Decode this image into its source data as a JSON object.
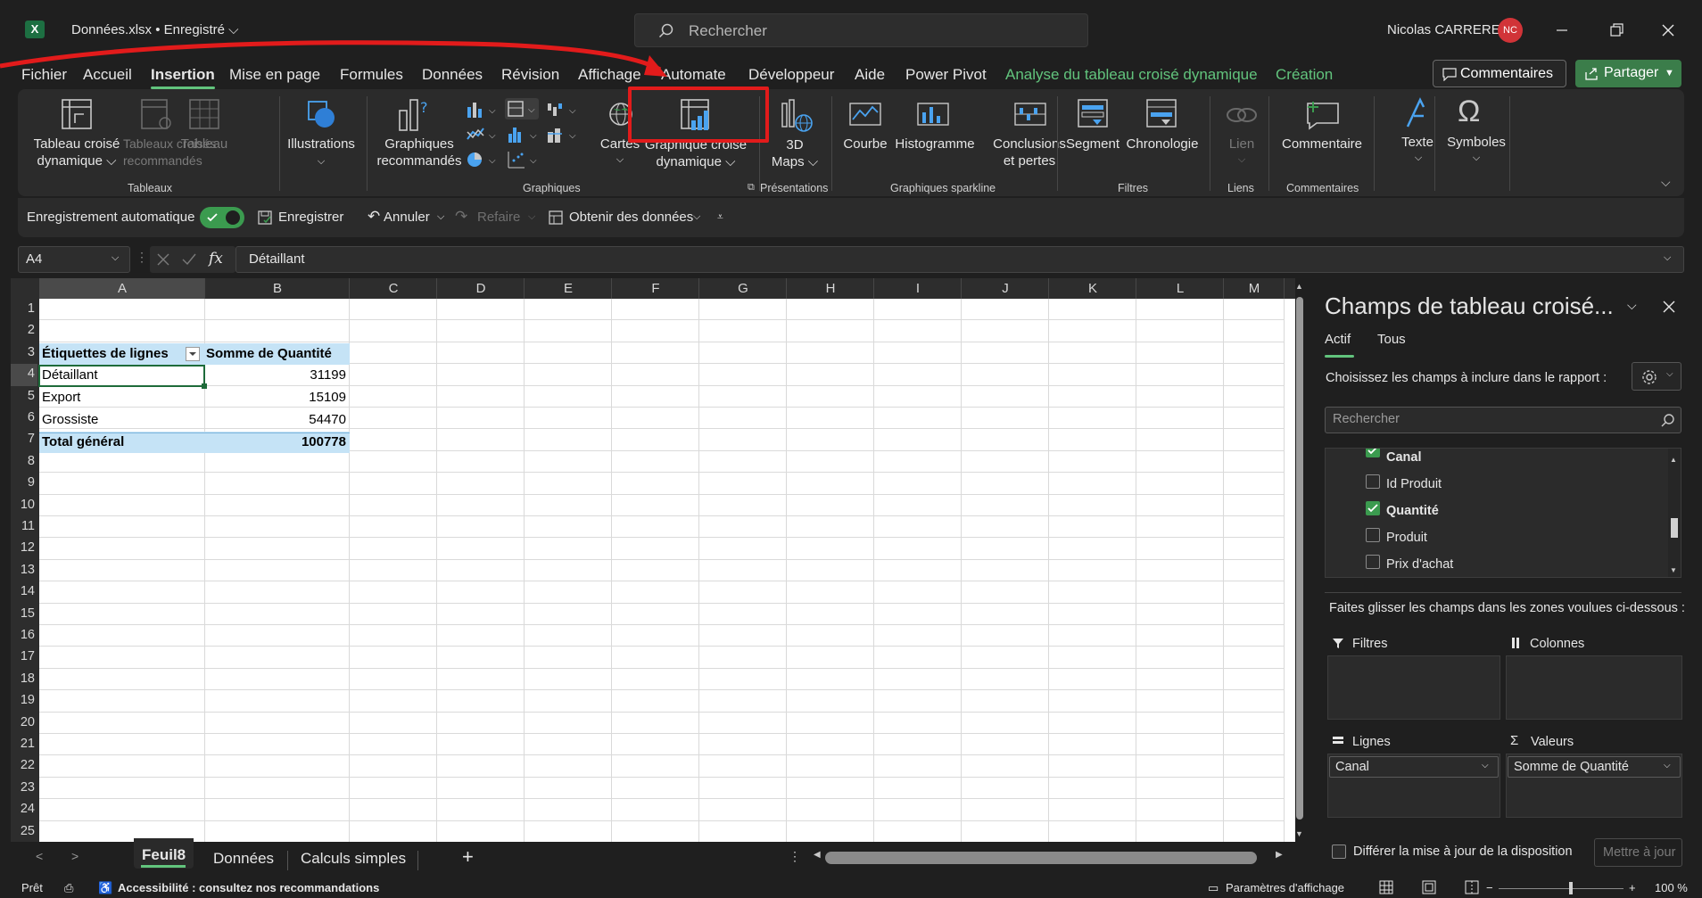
{
  "titlebar": {
    "app_icon": "X",
    "doc_title": "Données.xlsx • Enregistré ⌵",
    "search_placeholder": "Rechercher",
    "user_name": "Nicolas CARRERE",
    "user_initials": "NC"
  },
  "menu": {
    "tabs": [
      "Fichier",
      "Accueil",
      "Insertion",
      "Mise en page",
      "Formules",
      "Données",
      "Révision",
      "Affichage",
      "Automate",
      "Développeur",
      "Aide",
      "Power Pivot",
      "Analyse du tableau croisé dynamique",
      "Création"
    ],
    "active_tab": "Insertion",
    "comments_label": "Commentaires",
    "share_label": "Partager"
  },
  "ribbon": {
    "tableaux": {
      "pivot_table": "Tableau croisé\ndynamique ⌵",
      "recommended_pivots": "Tableaux croisés\nrecommandés",
      "table": "Tableau",
      "group": "Tableaux"
    },
    "illustrations": "Illustrations",
    "graphiques": {
      "recommended": "Graphiques\nrecommandés",
      "maps": "Cartes",
      "pivot_chart": "Graphique croisé\ndynamique ⌵",
      "group": "Graphiques"
    },
    "presentations": {
      "maps3d": "3D\nMaps ⌵",
      "group": "Présentations"
    },
    "sparklines": {
      "line": "Courbe",
      "column": "Histogramme",
      "win_loss": "Conclusions\net pertes",
      "group": "Graphiques sparkline"
    },
    "filtres": {
      "slicer": "Segment",
      "timeline": "Chronologie",
      "group": "Filtres"
    },
    "liens": {
      "link": "Lien",
      "group": "Liens"
    },
    "commentaires": {
      "comment": "Commentaire",
      "group": "Commentaires"
    },
    "texte": "Texte",
    "symboles": "Symboles"
  },
  "qat": {
    "autosave": "Enregistrement automatique",
    "save": "Enregistrer",
    "undo": "Annuler",
    "redo": "Refaire",
    "get_data": "Obtenir des données"
  },
  "formula_bar": {
    "name_box": "A4",
    "fx": "fx",
    "content": "Détaillant"
  },
  "grid": {
    "columns": [
      "A",
      "B",
      "C",
      "D",
      "E",
      "F",
      "G",
      "H",
      "I",
      "J",
      "K",
      "L",
      "M"
    ],
    "rows": [
      "1",
      "2",
      "3",
      "4",
      "5",
      "6",
      "7",
      "8",
      "9",
      "10",
      "11",
      "12",
      "13",
      "14",
      "15",
      "16",
      "17",
      "18",
      "19",
      "20",
      "21",
      "22",
      "23",
      "24",
      "25"
    ],
    "pivot": {
      "header_label": "Étiquettes de lignes",
      "header_value": "Somme de Quantité",
      "rows": [
        {
          "label": "Détaillant",
          "value": "31199"
        },
        {
          "label": "Export",
          "value": "15109"
        },
        {
          "label": "Grossiste",
          "value": "54470"
        }
      ],
      "total_label": "Total général",
      "total_value": "100778"
    }
  },
  "panel": {
    "title": "Champs de tableau croisé...",
    "tab_active": "Actif",
    "tab_all": "Tous",
    "choose_label": "Choisissez les champs à inclure dans le rapport :",
    "search_placeholder": "Rechercher",
    "fields": [
      {
        "name": "Canal",
        "checked": true
      },
      {
        "name": "Id Produit",
        "checked": false
      },
      {
        "name": "Quantité",
        "checked": true
      },
      {
        "name": "Produit",
        "checked": false
      },
      {
        "name": "Prix d'achat",
        "checked": false
      }
    ],
    "drag_label": "Faites glisser les champs dans les zones voulues ci-dessous :",
    "areas": {
      "filters": "Filtres",
      "columns": "Colonnes",
      "rows": "Lignes",
      "values": "Valeurs"
    },
    "rows_field": "Canal",
    "values_field": "Somme de Quantité",
    "defer_label": "Différer la mise à jour de la disposition",
    "update_button": "Mettre à jour"
  },
  "sheets": {
    "tabs": [
      "Feuil8",
      "Données",
      "Calculs simples"
    ],
    "active": "Feuil8"
  },
  "status": {
    "ready": "Prêt",
    "accessibility": "Accessibilité : consultez nos recommandations",
    "display_settings": "Paramètres d'affichage",
    "zoom": "100 %"
  },
  "colors": {
    "accent": "#62c47d",
    "highlight": "#e21b1b",
    "pivot_header": "#c5e3f6"
  }
}
